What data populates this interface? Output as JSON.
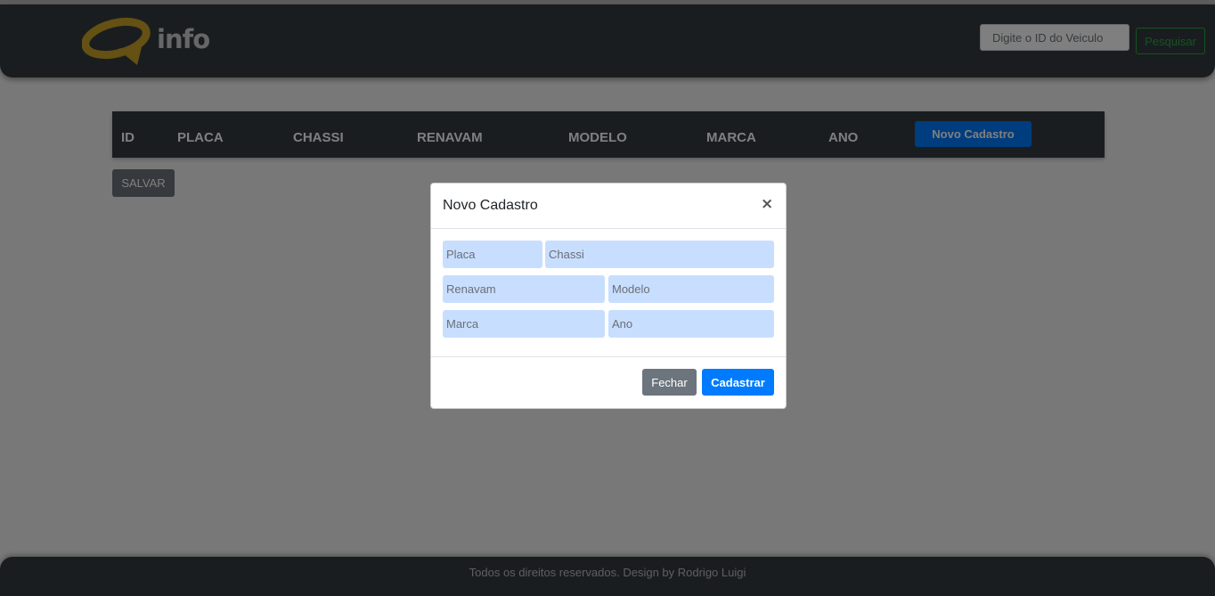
{
  "header": {
    "logo_text": "info",
    "search_placeholder": "Digite o ID do Veiculo",
    "search_button": "Pesquisar"
  },
  "table": {
    "columns": [
      "ID",
      "PLACA",
      "CHASSI",
      "RENAVAM",
      "MODELO",
      "MARCA",
      "ANO"
    ],
    "new_button": "Novo Cadastro"
  },
  "save_button": "SALVAR",
  "modal": {
    "title": "Novo Cadastro",
    "close_symbol": "×",
    "fields": {
      "placa": "Placa",
      "chassi": "Chassi",
      "renavam": "Renavam",
      "modelo": "Modelo",
      "marca": "Marca",
      "ano": "Ano"
    },
    "close_button": "Fechar",
    "submit_button": "Cadastrar"
  },
  "footer": {
    "text": "Todos os direitos reservados. Design by Rodrigo Luigi"
  },
  "colors": {
    "header_bg": "#343a40",
    "primary": "#007bff",
    "secondary": "#6c757d",
    "success": "#28a745",
    "input_bg": "#c8deff"
  }
}
